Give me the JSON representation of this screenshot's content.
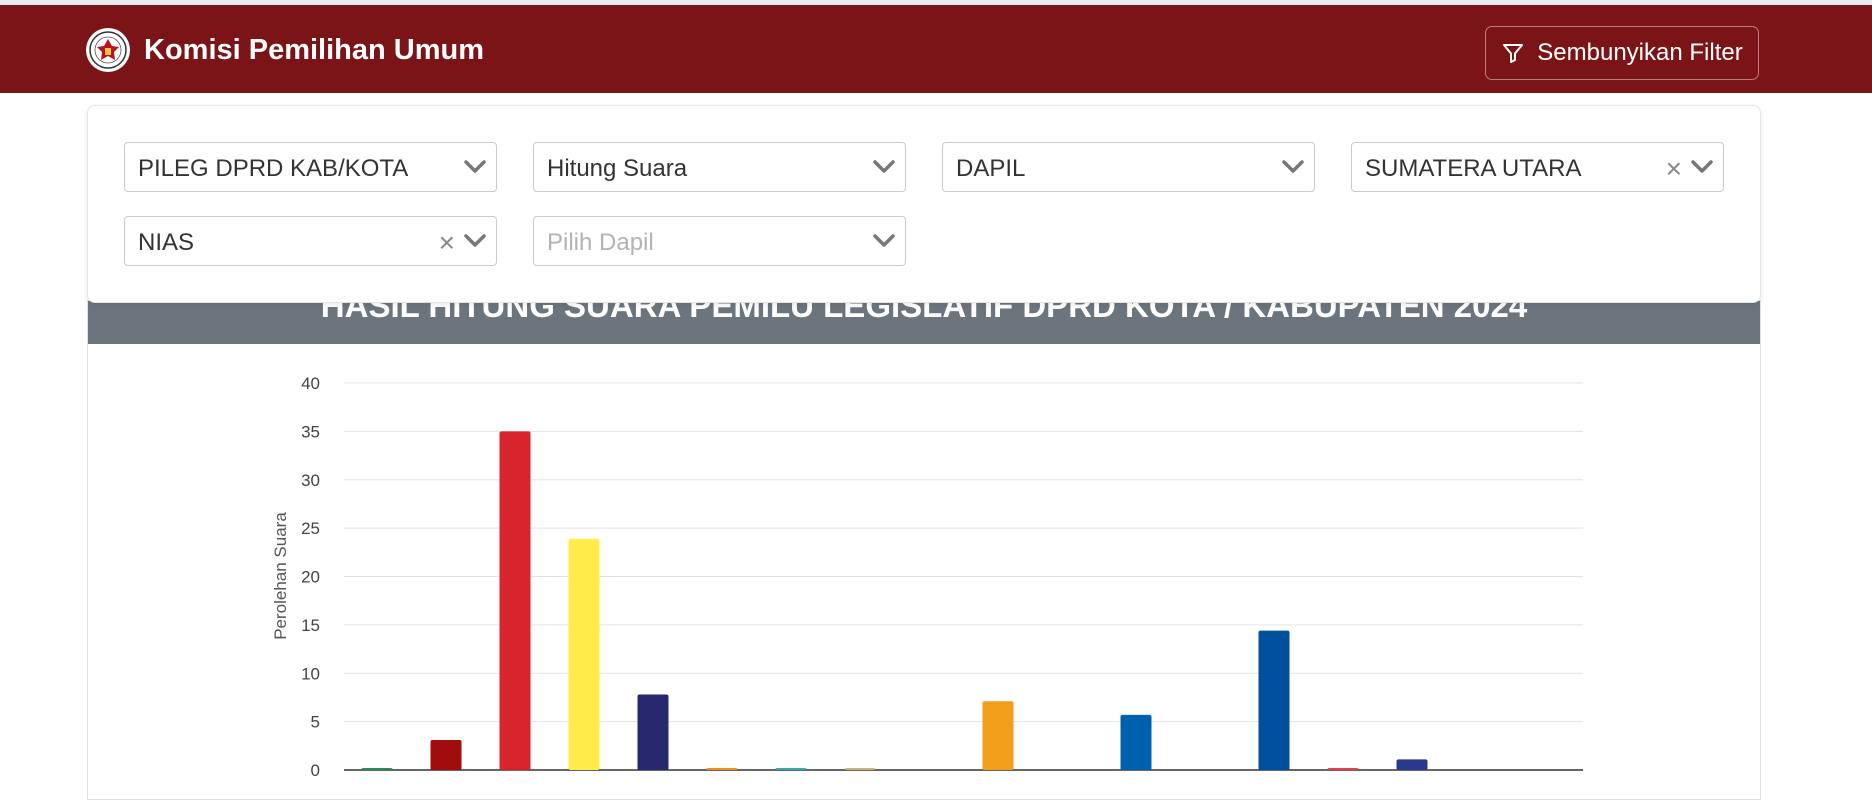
{
  "brand": {
    "title": "Komisi Pemilihan Umum"
  },
  "toolbar": {
    "filter_button_label": "Sembunyikan Filter"
  },
  "filters": {
    "election": "PILEG DPRD KAB/KOTA",
    "mode": "Hitung Suara",
    "level": "DAPIL",
    "province": "SUMATERA UTARA",
    "regency": "NIAS",
    "dapil_placeholder": "Pilih Dapil"
  },
  "chart_header": {
    "title": "HASIL HITUNG SUARA PEMILU LEGISLATIF DPRD KOTA / KABUPATEN 2024"
  },
  "chart_data": {
    "type": "bar",
    "title": "HASIL HITUNG SUARA PEMILU LEGISLATIF DPRD KOTA / KABUPATEN 2024",
    "ylabel": "Perolehan Suara",
    "ylim": [
      0,
      40
    ],
    "yticks": [
      0,
      5,
      10,
      15,
      20,
      25,
      30,
      35,
      40
    ],
    "grid": true,
    "values": [
      0.2,
      3.1,
      35,
      23.9,
      7.8,
      0.2,
      0.1,
      0.1,
      0,
      7.1,
      0,
      5.7,
      0,
      14.4,
      0.2,
      1.1,
      0,
      0
    ],
    "colors": [
      "#2e8b57",
      "#a10c0c",
      "#d9232d",
      "#ffec4a",
      "#27286e",
      "#f0901e",
      "#3aa8a8",
      "#c9b37a",
      "#cccccc",
      "#f29e1a",
      "#cccccc",
      "#0060b0",
      "#cccccc",
      "#00509e",
      "#e8404a",
      "#2a3a8a",
      "#cccccc",
      "#cccccc"
    ]
  }
}
